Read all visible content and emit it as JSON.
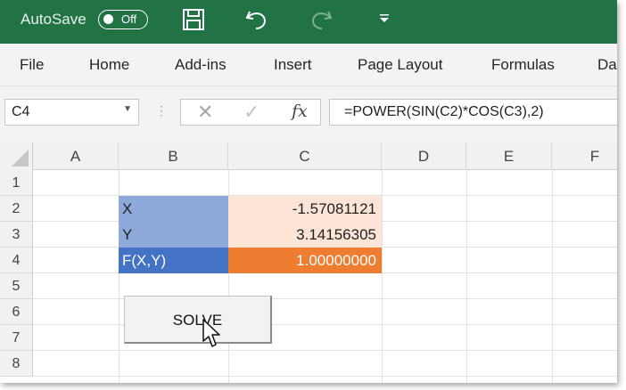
{
  "titlebar": {
    "autosave_label": "AutoSave",
    "toggle_state": "Off",
    "icons": [
      "save-icon",
      "undo-icon",
      "redo-icon",
      "customize-toolbar-icon"
    ],
    "bg_color": "#217346"
  },
  "ribbon": {
    "tabs": [
      "File",
      "Home",
      "Add-ins",
      "Insert",
      "Page Layout",
      "Formulas",
      "Da"
    ]
  },
  "formula_bar": {
    "name_box": "C4",
    "formula": "=POWER(SIN(C2)*COS(C3),2)",
    "fx_label": "fx"
  },
  "sheet": {
    "columns": [
      "A",
      "B",
      "C",
      "D",
      "E",
      "F"
    ],
    "rows": [
      "1",
      "2",
      "3",
      "4",
      "5",
      "6",
      "7",
      "8"
    ],
    "cells": [
      {
        "label": "X",
        "value": "-1.57081121"
      },
      {
        "label": "Y",
        "value": "3.14156305"
      },
      {
        "label": "F(X,Y)",
        "value": "1.00000000"
      }
    ],
    "colors": {
      "label_fill": "#8eaadb",
      "value_fill": "#fce4d6",
      "result_label_fill": "#4472c4",
      "result_value_fill": "#ed7d31"
    }
  },
  "solve_button": {
    "label": "SOLVE"
  }
}
